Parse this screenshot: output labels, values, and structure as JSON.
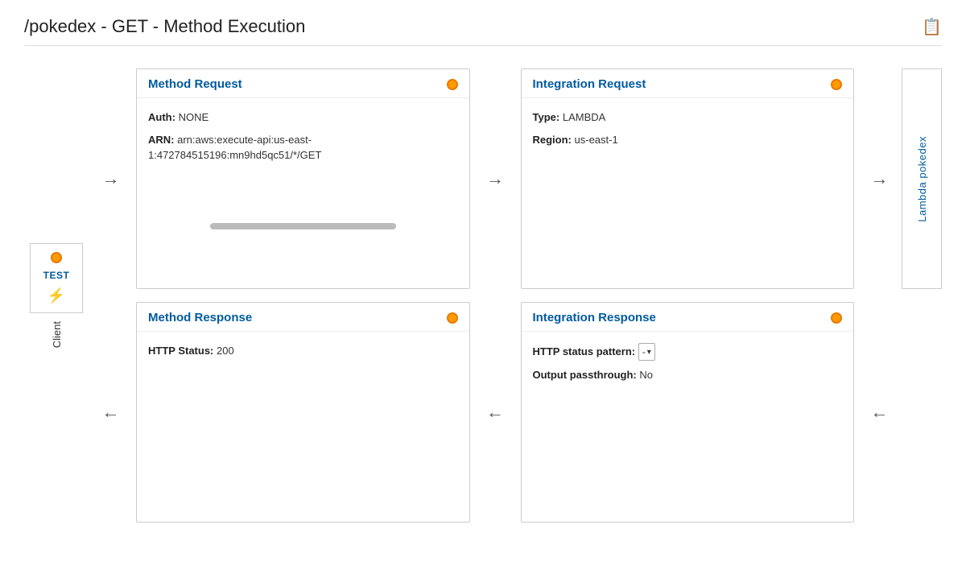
{
  "header": {
    "title": "/pokedex - GET - Method Execution",
    "icon": "📋"
  },
  "client": {
    "label": "TEST",
    "lightning": "⚡"
  },
  "method_request": {
    "title": "Method Request",
    "auth_label": "Auth:",
    "auth_value": "NONE",
    "arn_label": "ARN:",
    "arn_value": "arn:aws:execute-api:us-east-1:472784515196:mn9hd5qc51/*/GET"
  },
  "integration_request": {
    "title": "Integration Request",
    "type_label": "Type:",
    "type_value": "LAMBDA",
    "region_label": "Region:",
    "region_value": "us-east-1"
  },
  "method_response": {
    "title": "Method Response",
    "http_status_label": "HTTP Status:",
    "http_status_value": "200"
  },
  "integration_response": {
    "title": "Integration Response",
    "http_status_pattern_label": "HTTP status pattern:",
    "http_status_pattern_value": "-",
    "output_passthrough_label": "Output passthrough:",
    "output_passthrough_value": "No"
  },
  "lambda": {
    "label": "Lambda pokedex"
  },
  "arrows": {
    "right": "→",
    "left": "←"
  }
}
